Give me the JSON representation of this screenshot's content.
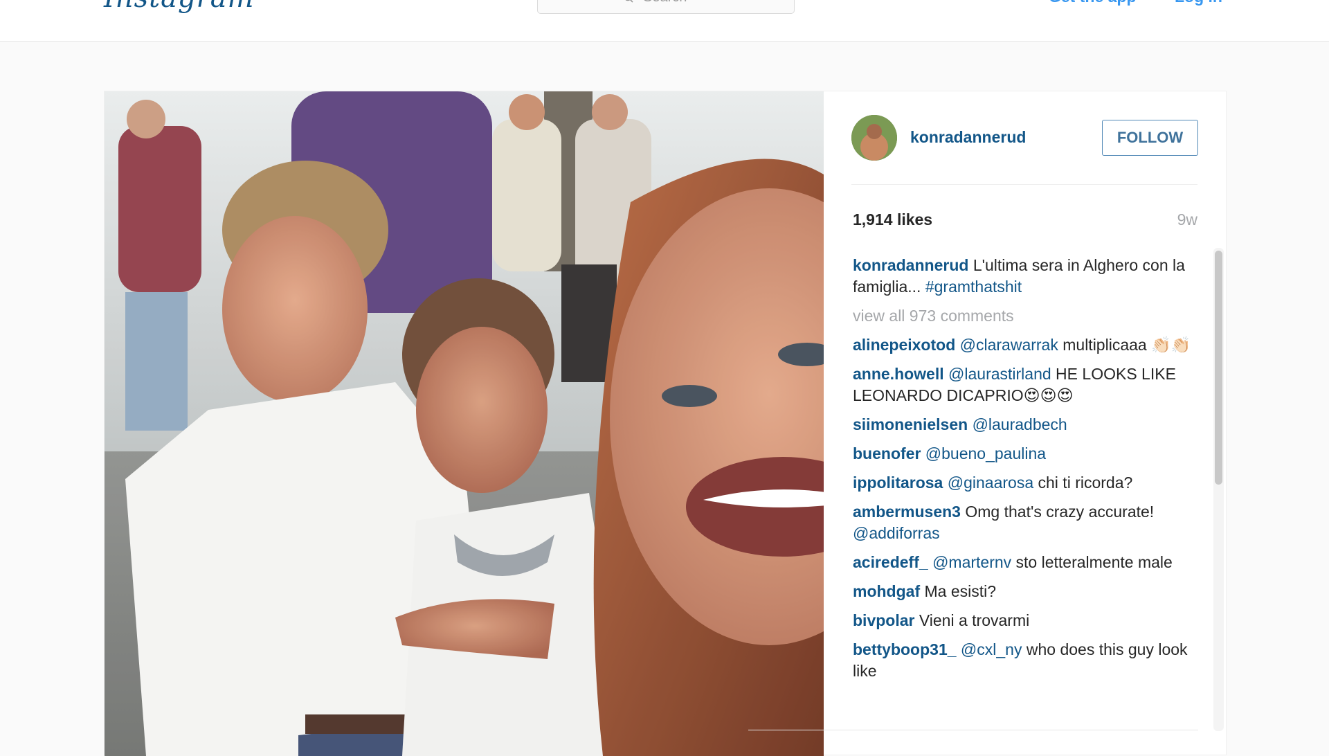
{
  "header": {
    "logo_text": "Instagram",
    "search_placeholder": "Search",
    "get_app": "Get the app",
    "login": "Log in"
  },
  "post": {
    "author": "konradannerud",
    "follow_label": "FOLLOW",
    "likes": "1,914 likes",
    "age": "9w",
    "caption": {
      "user": "konradannerud",
      "text": "L'ultima sera in Alghero con la famiglia... ",
      "hashtag": "#gramthatshit"
    },
    "view_all": "view all 973 comments",
    "comments": [
      {
        "user": "alinepeixotod",
        "mention": "@clarawarrak",
        "text": " multiplicaaa 👏🏻👏🏻"
      },
      {
        "user": "anne.howell",
        "mention": "@laurastirland",
        "text": " HE LOOKS LIKE LEONARDO DICAPRIO😍😍😍"
      },
      {
        "user": "siimonenielsen",
        "mention": "@lauradbech",
        "text": ""
      },
      {
        "user": "buenofer",
        "mention": "@bueno_paulina",
        "text": ""
      },
      {
        "user": "ippolitarosa",
        "mention": "@ginaarosa",
        "text": " chi ti ricorda?"
      },
      {
        "user": "ambermusen3",
        "mention": "",
        "text": "Omg that's crazy accurate! ",
        "mention2": "@addiforras"
      },
      {
        "user": "aciredeff_",
        "mention": "@marternv",
        "text": " sto letteralmente male"
      },
      {
        "user": "mohdgaf",
        "mention": "",
        "text": "Ma esisti?"
      },
      {
        "user": "bivpolar",
        "mention": "",
        "text": "Vieni a trovarmi"
      },
      {
        "user": "bettyboop31_",
        "mention": "@cxl_ny",
        "text": " who does this guy look like"
      }
    ]
  },
  "colors": {
    "link_blue": "#125688",
    "accent_blue": "#3897f0",
    "muted_gray": "#a5a7aa"
  }
}
